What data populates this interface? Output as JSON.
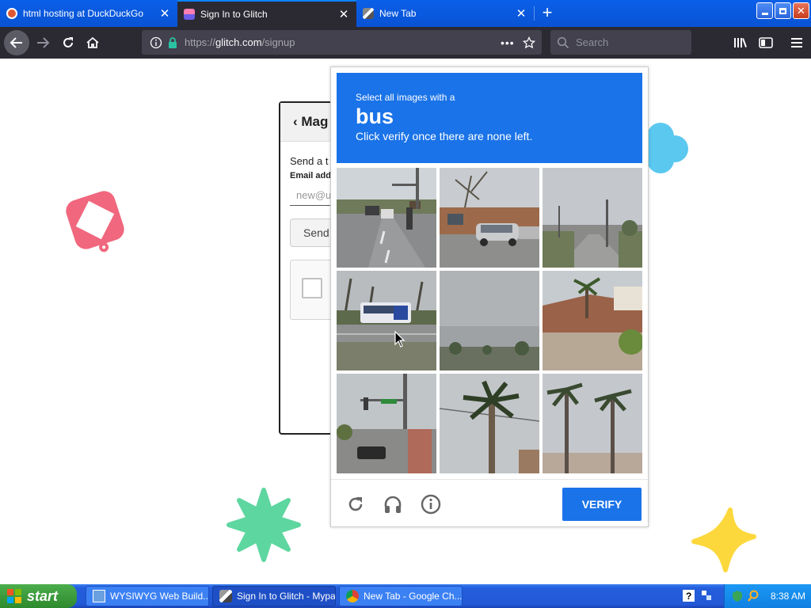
{
  "browser": {
    "tabs": [
      {
        "title": "html hosting at DuckDuckGo",
        "active": false
      },
      {
        "title": "Sign In to Glitch",
        "active": true
      },
      {
        "title": "New Tab",
        "active": false
      }
    ],
    "new_tab_symbol": "+",
    "url_host": "glitch.com",
    "url_prefix": "https://",
    "url_path": "/signup",
    "url_more": "•••",
    "search_placeholder": "Search",
    "window_controls": {
      "minimize": "_",
      "maximize": "❐",
      "close": "✕"
    }
  },
  "signup_card": {
    "back_label": "Mag",
    "send_text": "Send a t",
    "email_label": "Email add",
    "email_placeholder": "new@u",
    "send_button": "Send"
  },
  "captcha": {
    "line1": "Select all images with a",
    "keyword": "bus",
    "line2": "Click verify once there are none left.",
    "verify_label": "VERIFY",
    "tiles": [
      "street-traffic",
      "parked-cars",
      "road-intersection",
      "bus-on-road",
      "cloudy-sky",
      "palm-tree-roof",
      "traffic-light-corner",
      "palm-tree-pole",
      "palm-trees-building"
    ]
  },
  "taskbar": {
    "start_label": "start",
    "tasks": [
      {
        "label": "WYSIWYG Web Build...",
        "icon": "wysiwyg-icon"
      },
      {
        "label": "Sign In to Glitch - Mypal",
        "icon": "mypal-icon"
      },
      {
        "label": "New Tab - Google Ch...",
        "icon": "chrome-icon"
      }
    ],
    "clock": "8:38 AM"
  },
  "colors": {
    "captcha_blue": "#1a73e8",
    "titlebar_blue": "#0a58e4",
    "navbar_dark": "#2b2a33",
    "start_green": "#3c9b3c"
  }
}
